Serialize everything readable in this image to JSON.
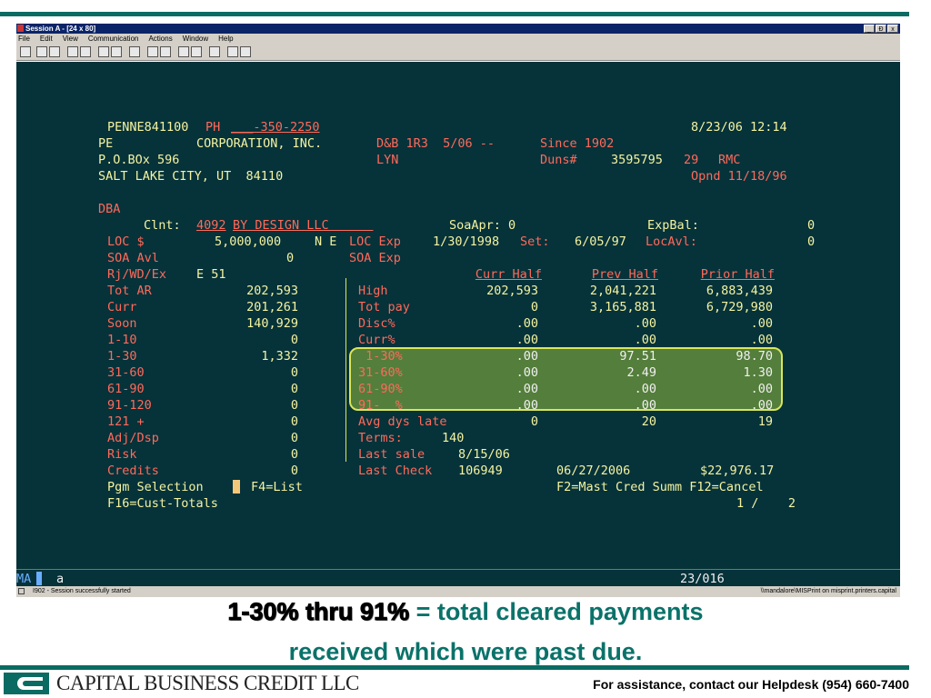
{
  "window": {
    "title": "Session A - [24 x 80]",
    "buttons": [
      "_",
      "Ɖ",
      "x"
    ]
  },
  "menu": [
    "File",
    "Edit",
    "View",
    "Communication",
    "Actions",
    "Window",
    "Help"
  ],
  "terminal": {
    "header": {
      "account": "PENNE841100",
      "ph_label": "PH",
      "phone": "___-350-2250",
      "datetime": "8/23/06 12:14",
      "company_prefix": "PE",
      "company_name": "CORPORATION, INC.",
      "dnb": "D&B 1R3  5/06 --",
      "since": "Since 1902",
      "po_box": "P.O.BOx 596",
      "lyn": "LYN",
      "duns_label": "Duns#",
      "duns_num": "3595795",
      "duns_suffix": "29",
      "rmc": "RMC",
      "city": "SALT LAKE CITY, UT  84110",
      "opnd": "Opnd 11/18/96",
      "dba": "DBA"
    },
    "client": {
      "clnt_label": "Clnt:",
      "clnt_num": "4092",
      "clnt_name": "BY DESIGN LLC      ",
      "soaapr": "SoaApr: 0",
      "expbal_label": "ExpBal:",
      "expbal_val": "0",
      "loc_label": "LOC $",
      "loc_value": "5,000,000",
      "ne": "N E",
      "locexp_label": "LOC Exp",
      "locexp_val": "1/30/1998",
      "set_label": "Set:",
      "set_val": "6/05/97",
      "locavl_label": "LocAvl:",
      "locavl_val": "0",
      "soa_avl_label": "SOA Avl",
      "soa_avl_val": "0",
      "soa_exp": "SOA Exp",
      "rj_label": "Rj/WD/Ex",
      "rj_val": "E 51"
    },
    "aging": [
      {
        "label": "Tot AR",
        "value": "202,593"
      },
      {
        "label": "Curr",
        "value": "201,261"
      },
      {
        "label": "Soon",
        "value": "140,929"
      },
      {
        "label": "1-10",
        "value": "0"
      },
      {
        "label": "1-30",
        "value": "1,332"
      },
      {
        "label": "31-60",
        "value": "0"
      },
      {
        "label": "61-90",
        "value": "0"
      },
      {
        "label": "91-120",
        "value": "0"
      },
      {
        "label": "121 +",
        "value": "0"
      },
      {
        "label": "Adj/Dsp",
        "value": "0"
      },
      {
        "label": "Risk",
        "value": "0"
      },
      {
        "label": "Credits",
        "value": "0"
      }
    ],
    "columns": [
      "Curr Half",
      "Prev Half",
      "Prior Half"
    ],
    "history": [
      {
        "label": "High",
        "curr": "202,593",
        "prev": "2,041,221",
        "prior": "6,883,439"
      },
      {
        "label": "Tot pay",
        "curr": "0",
        "prev": "3,165,881",
        "prior": "6,729,980"
      },
      {
        "label": "Disc%",
        "curr": ".00",
        "prev": ".00",
        "prior": ".00"
      },
      {
        "label": "Curr%",
        "curr": ".00",
        "prev": ".00",
        "prior": ".00"
      },
      {
        "label": " 1-30%",
        "curr": ".00",
        "prev": "97.51",
        "prior": "98.70"
      },
      {
        "label": "31-60%",
        "curr": ".00",
        "prev": "2.49",
        "prior": "1.30"
      },
      {
        "label": "61-90%",
        "curr": ".00",
        "prev": ".00",
        "prior": ".00"
      },
      {
        "label": "91-  %",
        "curr": ".00",
        "prev": ".00",
        "prior": ".00"
      },
      {
        "label": "Avg dys late",
        "curr": "0",
        "prev": "20",
        "prior": "19"
      }
    ],
    "footer": {
      "terms_label": "Terms:",
      "terms_val": "140",
      "last_sale_label": "Last sale",
      "last_sale_val": "8/15/06",
      "last_check_label": "Last Check",
      "last_check_val": "106949",
      "last_check_date": "06/27/2006",
      "last_check_amt": "$22,976.17",
      "pgm_selection": "Pgm Selection",
      "f4": "F4=List",
      "f2": "F2=Mast Cred Summ F12=Cancel",
      "f16": "F16=Cust-Totals",
      "page": "1 /    2"
    },
    "oia": {
      "mode": "MA",
      "input": "a",
      "cursor_pos": "23/016"
    }
  },
  "statusbar": {
    "left": "I902 - Session successfully started",
    "right": "\\\\mandalore\\MISPrint on misprint.printers.capital"
  },
  "caption": {
    "highlight": "1-30% thru 91%",
    "rest": " = total cleared payments",
    "line2": "received which were past due."
  },
  "branding": {
    "company": "CAPITAL BUSINESS CREDIT LLC",
    "help": "For assistance, contact our Helpdesk (954) 660-7400"
  },
  "colors": {
    "terminal_bg": "#06323a",
    "brand_teal": "#0a6b62",
    "highlight": "#d8e65a",
    "caption_text": "#0a7269"
  }
}
